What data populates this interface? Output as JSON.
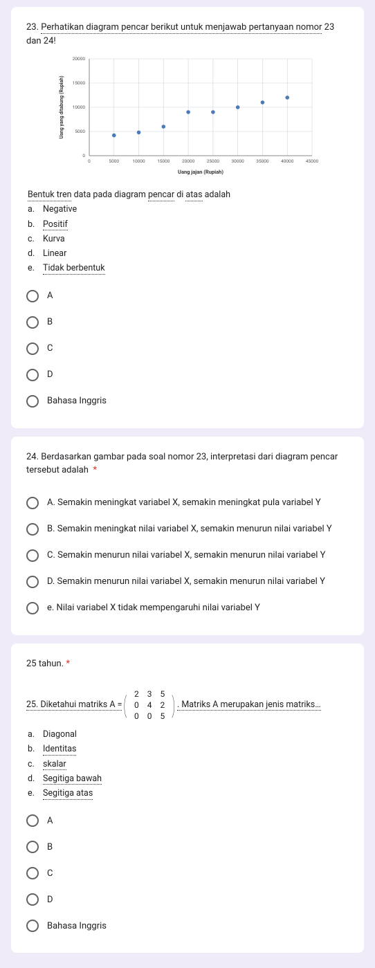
{
  "q23": {
    "title_prefix": "23. ",
    "title_text": "Perhatikan diagram pencar berikut untuk menjawab pertanyaan nomor",
    "title_suffix": " 23 dan 24!",
    "sub_prefix": "Bentuk tren",
    "sub_mid": " data pada diagram ",
    "sub_pencar": "pencar",
    "sub_di": " di ",
    "sub_atas": "atas",
    "sub_adalah": " adalah",
    "items": [
      {
        "m": "a.",
        "t": "Negative",
        "u": false
      },
      {
        "m": "b.",
        "t": "Positif",
        "u": true
      },
      {
        "m": "c.",
        "t": "Kurva",
        "u": false
      },
      {
        "m": "d.",
        "t": "Linear",
        "u": false
      },
      {
        "m": "e.",
        "t": "Tidak berbentuk",
        "u": true
      }
    ],
    "options": [
      "A",
      "B",
      "C",
      "D",
      "Bahasa Inggris"
    ]
  },
  "q24": {
    "title": "24. Berdasarkan gambar pada soal nomor 23, interpretasi dari diagram pencar tersebut adalah",
    "star": "*",
    "options": [
      "A. Semakin meningkat variabel X, semakin meningkat pula variabel Y",
      "B. Semakin meningkat nilai variabel X, semakin menurun nilai variabel Y",
      "C. Semakin menurun nilai variabel X, semakin menurun nilai variabel Y",
      "D. Semakin menurun nilai variabel X, semakin menurun nilai variabel Y",
      "e. Nilai variabel X tidak mempengaruhi nilai variabel Y"
    ]
  },
  "q25": {
    "heading": "25 tahun. *",
    "pre": "25. Diketahui matriks A = ",
    "matrix": [
      [
        "2",
        "3",
        "5"
      ],
      [
        "0",
        "4",
        "2"
      ],
      [
        "0",
        "0",
        "5"
      ]
    ],
    "post": ". Matriks A merupakan jenis matriks…",
    "items": [
      {
        "m": "a.",
        "t": "Diagonal",
        "u": false
      },
      {
        "m": "b.",
        "t": "Identitas",
        "u": true
      },
      {
        "m": "c.",
        "t": "skalar",
        "u": true
      },
      {
        "m": "d.",
        "t": "Segitiga bawah",
        "u": true
      },
      {
        "m": "e.",
        "t": "Segitiga atas",
        "u": true
      }
    ],
    "options": [
      "A",
      "B",
      "C",
      "D",
      "Bahasa Inggris"
    ]
  },
  "chart_data": {
    "type": "scatter",
    "title": "",
    "xlabel": "Uang jajan (Rupiah)",
    "ylabel": "Uang yang ditabung (Rupiah)",
    "xlim": [
      0,
      45000
    ],
    "ylim": [
      0,
      20000
    ],
    "xticks": [
      0,
      5000,
      10000,
      15000,
      20000,
      25000,
      30000,
      35000,
      40000,
      45000
    ],
    "yticks": [
      0,
      5000,
      10000,
      15000,
      20000
    ],
    "points": [
      {
        "x": 5000,
        "y": 4200
      },
      {
        "x": 10000,
        "y": 4800
      },
      {
        "x": 15000,
        "y": 6000
      },
      {
        "x": 20000,
        "y": 9000
      },
      {
        "x": 25000,
        "y": 9000
      },
      {
        "x": 30000,
        "y": 10000
      },
      {
        "x": 35000,
        "y": 11000
      },
      {
        "x": 40000,
        "y": 12000
      }
    ]
  }
}
